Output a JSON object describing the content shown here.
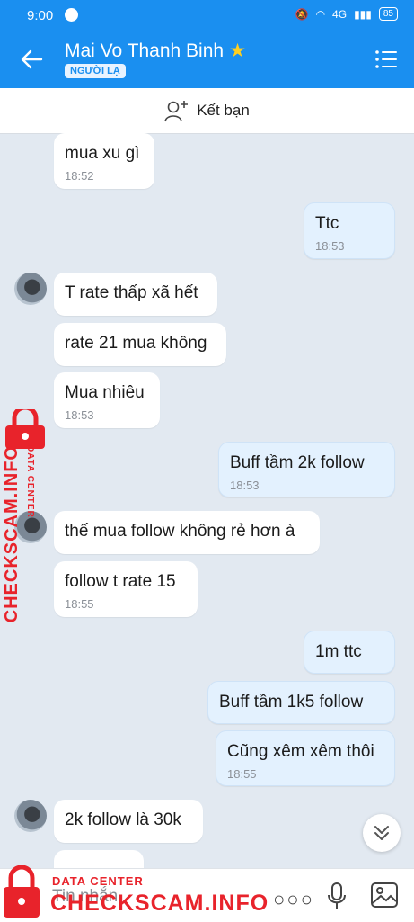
{
  "status_bar": {
    "time": "9:00",
    "network": "4G",
    "battery": "85"
  },
  "header": {
    "title": "Mai Vo Thanh Binh",
    "badge": "NGƯỜI LẠ"
  },
  "friend_bar": {
    "label": "Kết bạn"
  },
  "messages": [
    {
      "dir": "in",
      "text": "mua xu gì",
      "time": "18:52"
    },
    {
      "dir": "out",
      "text": "Ttc",
      "time": "18:53"
    },
    {
      "dir": "in",
      "text": "T rate thấp xã hết",
      "time": ""
    },
    {
      "dir": "in",
      "text": "rate 21 mua không",
      "time": ""
    },
    {
      "dir": "in",
      "text": "Mua nhiêu",
      "time": "18:53"
    },
    {
      "dir": "out",
      "text": "Buff tầm 2k follow",
      "time": "18:53"
    },
    {
      "dir": "in",
      "text": "thế mua follow không rẻ hơn à",
      "time": ""
    },
    {
      "dir": "in",
      "text": "follow t rate 15",
      "time": "18:55"
    },
    {
      "dir": "out",
      "text": "1m ttc",
      "time": ""
    },
    {
      "dir": "out",
      "text": "Buff tầm 1k5 follow",
      "time": ""
    },
    {
      "dir": "out",
      "text": "Cũng xêm xêm thôi",
      "time": "18:55"
    },
    {
      "dir": "in",
      "text": "2k follow là 30k",
      "time": ""
    }
  ],
  "input": {
    "placeholder": "Tin nhắn"
  },
  "watermark": {
    "small": "DATA CENTER",
    "big": "CHECKSCAM.INFO"
  },
  "colors": {
    "header": "#1a8ff0",
    "chat_bg": "#e2e9f1",
    "out_bubble": "#e3f1fe",
    "watermark": "#e8232b"
  }
}
